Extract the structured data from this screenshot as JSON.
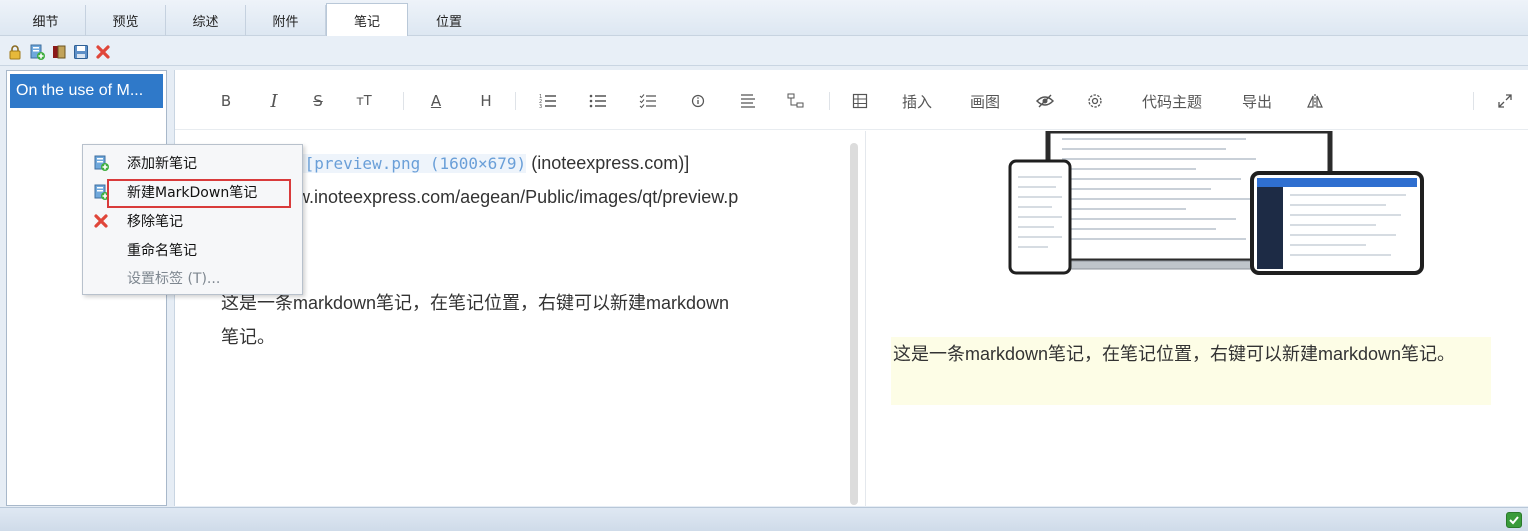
{
  "tabs": [
    {
      "label": "细节",
      "active": false
    },
    {
      "label": "预览",
      "active": false
    },
    {
      "label": "综述",
      "active": false
    },
    {
      "label": "附件",
      "active": false
    },
    {
      "label": "笔记",
      "active": true
    },
    {
      "label": "位置",
      "active": false
    }
  ],
  "toolbar": {
    "icons": [
      "lock-icon",
      "add-note-icon",
      "book-icon",
      "save-icon",
      "delete-icon"
    ]
  },
  "note_list": {
    "items": [
      {
        "label": "On the use of M..."
      }
    ]
  },
  "md_toolbar": {
    "bold": "B",
    "italic": "I",
    "strike": "S",
    "font_size": "тT",
    "font_color": "A",
    "heading": "H",
    "insert": "插入",
    "draw": "画图",
    "code_theme": "代码主题",
    "export": "导出"
  },
  "editor": {
    "line1_link_text": "[[preview.png (1600×679)",
    "line1_suffix": "(inoteexpress.com)]",
    "line2": "w.inoteexpress.com/aegean/Public/images/qt/preview.p",
    "para_line1": "这是一条markdown笔记，在笔记位置，右键可以新建markdown",
    "para_line2": "笔记。"
  },
  "preview": {
    "paragraph": "这是一条markdown笔记，在笔记位置，右键可以新建markdown笔记。"
  },
  "context_menu": {
    "items": [
      {
        "label": "添加新笔记",
        "icon": "add-note-icon",
        "enabled": true
      },
      {
        "label": "新建MarkDown笔记",
        "icon": "add-note-icon",
        "enabled": true,
        "highlighted": true
      },
      {
        "label": "移除笔记",
        "icon": "delete-icon",
        "enabled": true
      },
      {
        "label": "重命名笔记",
        "icon": "",
        "enabled": true
      },
      {
        "label": "设置标签 (T)...",
        "icon": "",
        "enabled": false
      }
    ]
  },
  "colors": {
    "selection": "#2f79c9",
    "highlight_border": "#d93b3b",
    "preview_bg": "#fdfde6"
  }
}
